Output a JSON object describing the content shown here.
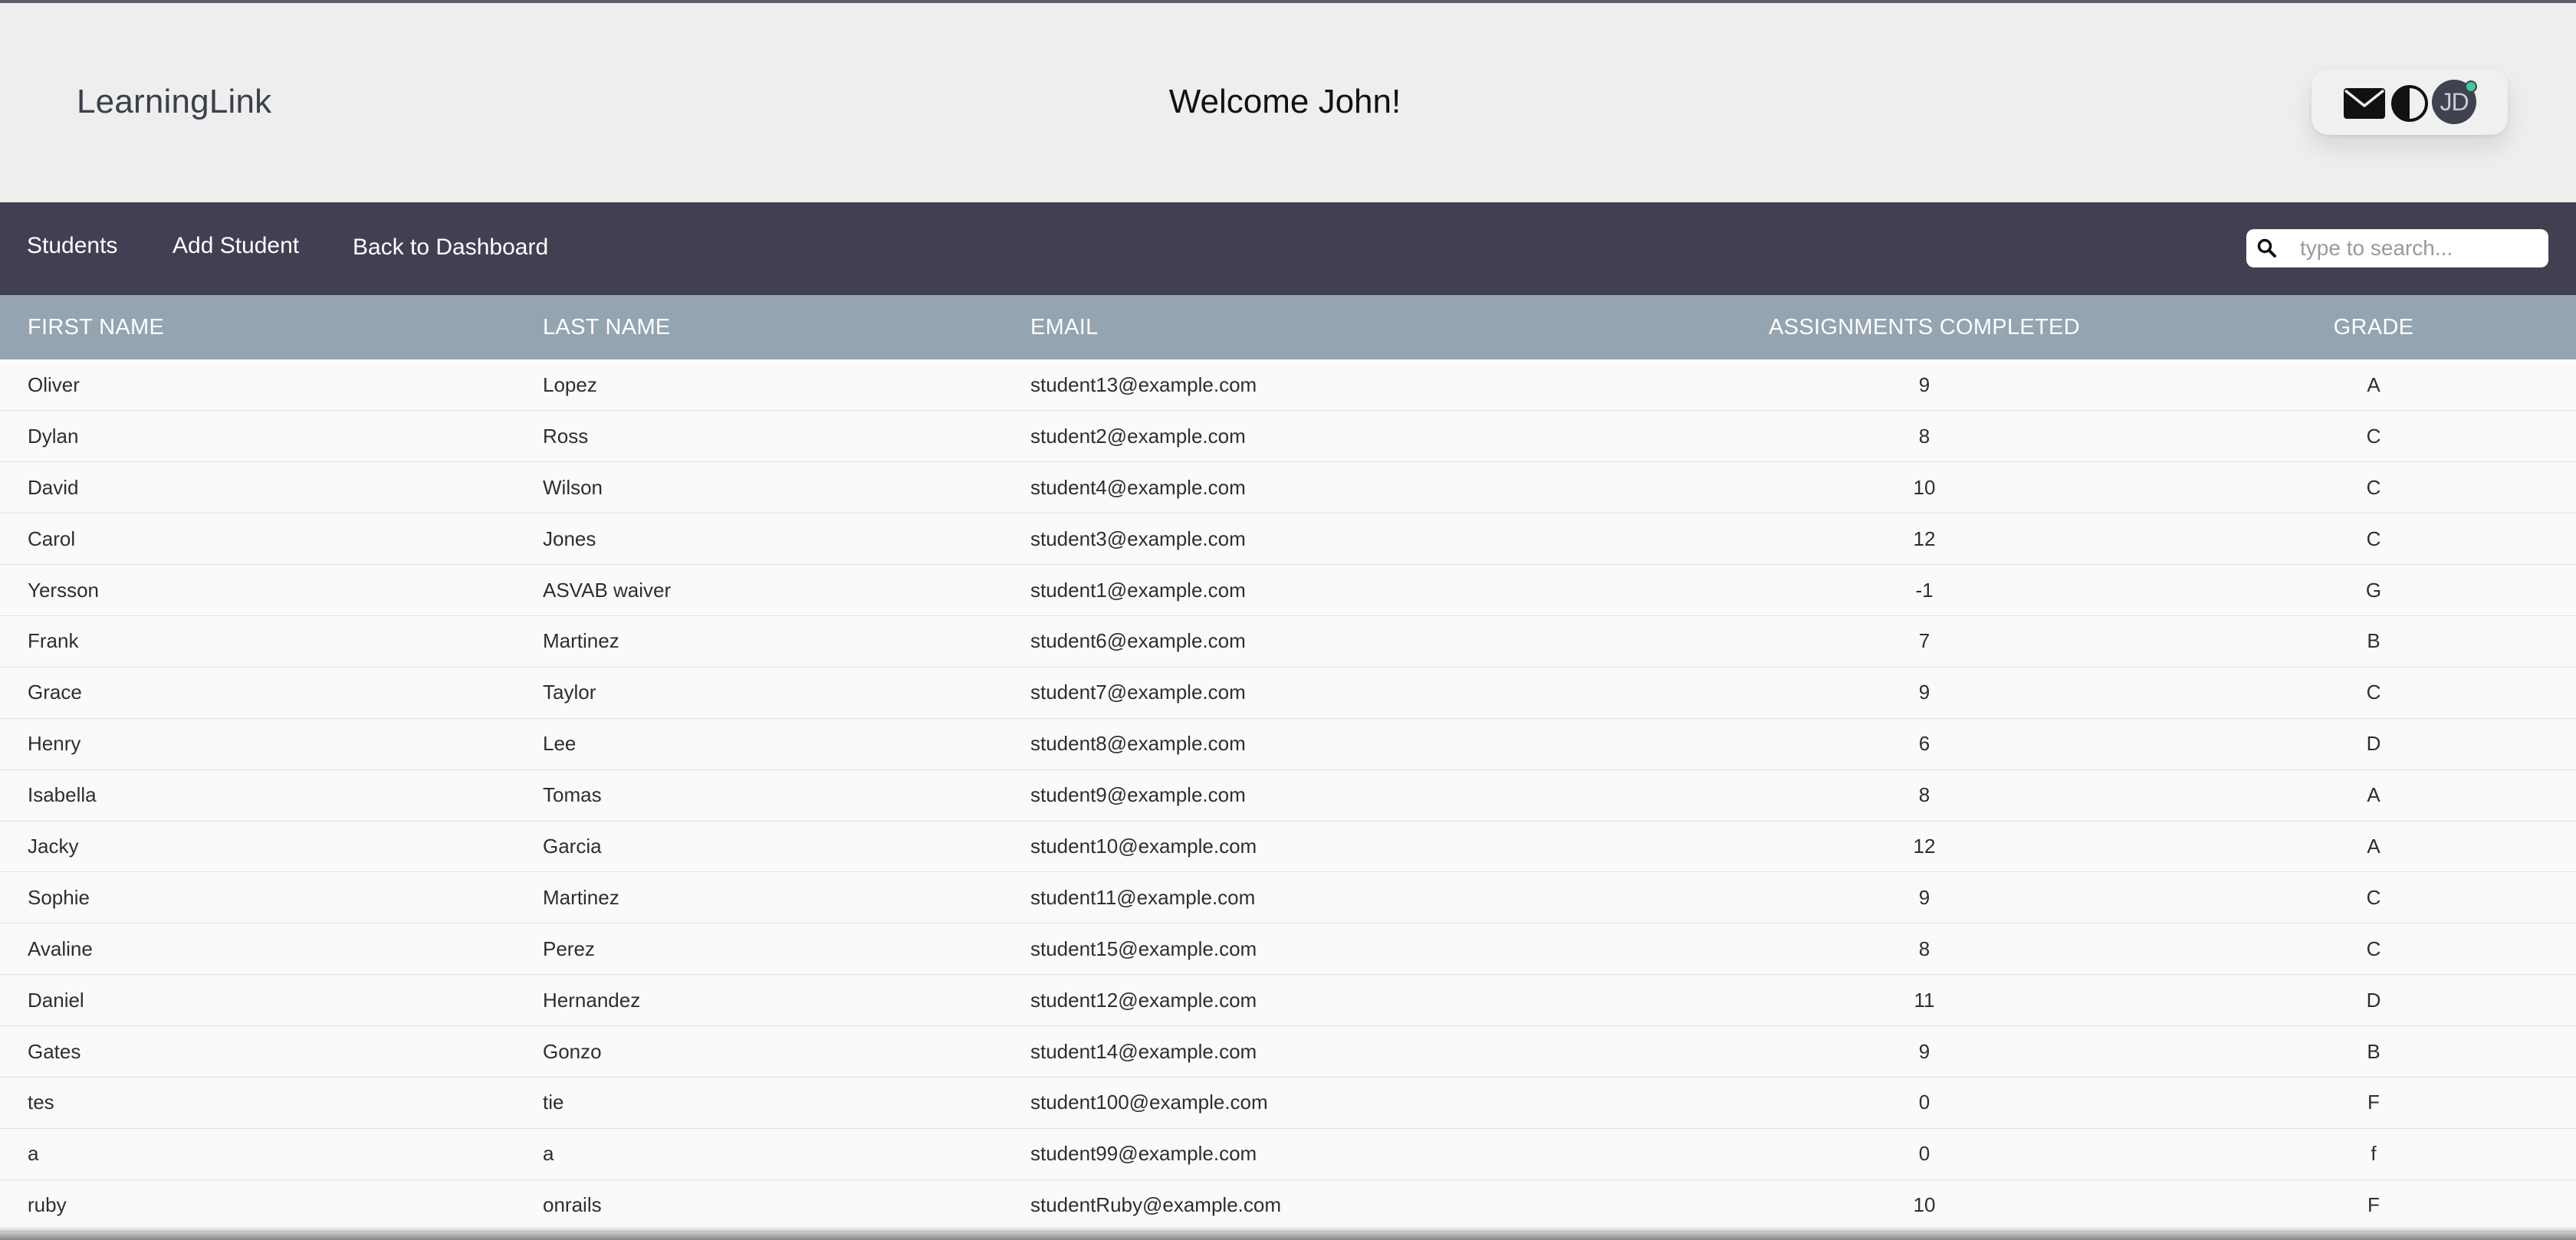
{
  "header": {
    "brand": "LearningLink",
    "welcome": "Welcome John!",
    "icons": [
      "mail-icon",
      "contrast-icon"
    ],
    "avatar_initials": "JD"
  },
  "nav": {
    "items": [
      {
        "label": "Students"
      },
      {
        "label": "Add Student"
      },
      {
        "label": "Back to Dashboard"
      }
    ],
    "search": {
      "placeholder": "type to search...",
      "value": ""
    }
  },
  "table": {
    "columns": [
      "FIRST NAME",
      "LAST NAME",
      "EMAIL",
      "ASSIGNMENTS COMPLETED",
      "GRADE"
    ],
    "rows": [
      [
        "Oliver",
        "Lopez",
        "student13@example.com",
        "9",
        "A"
      ],
      [
        "Dylan",
        "Ross",
        "student2@example.com",
        "8",
        "C"
      ],
      [
        "David",
        "Wilson",
        "student4@example.com",
        "10",
        "C"
      ],
      [
        "Carol",
        "Jones",
        "student3@example.com",
        "12",
        "C"
      ],
      [
        "Yersson",
        "ASVAB waiver",
        "student1@example.com",
        "-1",
        "G"
      ],
      [
        "Frank",
        "Martinez",
        "student6@example.com",
        "7",
        "B"
      ],
      [
        "Grace",
        "Taylor",
        "student7@example.com",
        "9",
        "C"
      ],
      [
        "Henry",
        "Lee",
        "student8@example.com",
        "6",
        "D"
      ],
      [
        "Isabella",
        "Tomas",
        "student9@example.com",
        "8",
        "A"
      ],
      [
        "Jacky",
        "Garcia",
        "student10@example.com",
        "12",
        "A"
      ],
      [
        "Sophie",
        "Martinez",
        "student11@example.com",
        "9",
        "C"
      ],
      [
        "Avaline",
        "Perez",
        "student15@example.com",
        "8",
        "C"
      ],
      [
        "Daniel",
        "Hernandez",
        "student12@example.com",
        "11",
        "D"
      ],
      [
        "Gates",
        "Gonzo",
        "student14@example.com",
        "9",
        "B"
      ],
      [
        "tes",
        "tie",
        "student100@example.com",
        "0",
        "F"
      ],
      [
        "a",
        "a",
        "student99@example.com",
        "0",
        "f"
      ],
      [
        "ruby",
        "onrails",
        "studentRuby@example.com",
        "10",
        "F"
      ]
    ]
  },
  "colors": {
    "header_bg": "#eeeeee",
    "nav_bg": "#404052",
    "table_header_bg": "#94a4b0",
    "row_bg": "#fafafa"
  }
}
